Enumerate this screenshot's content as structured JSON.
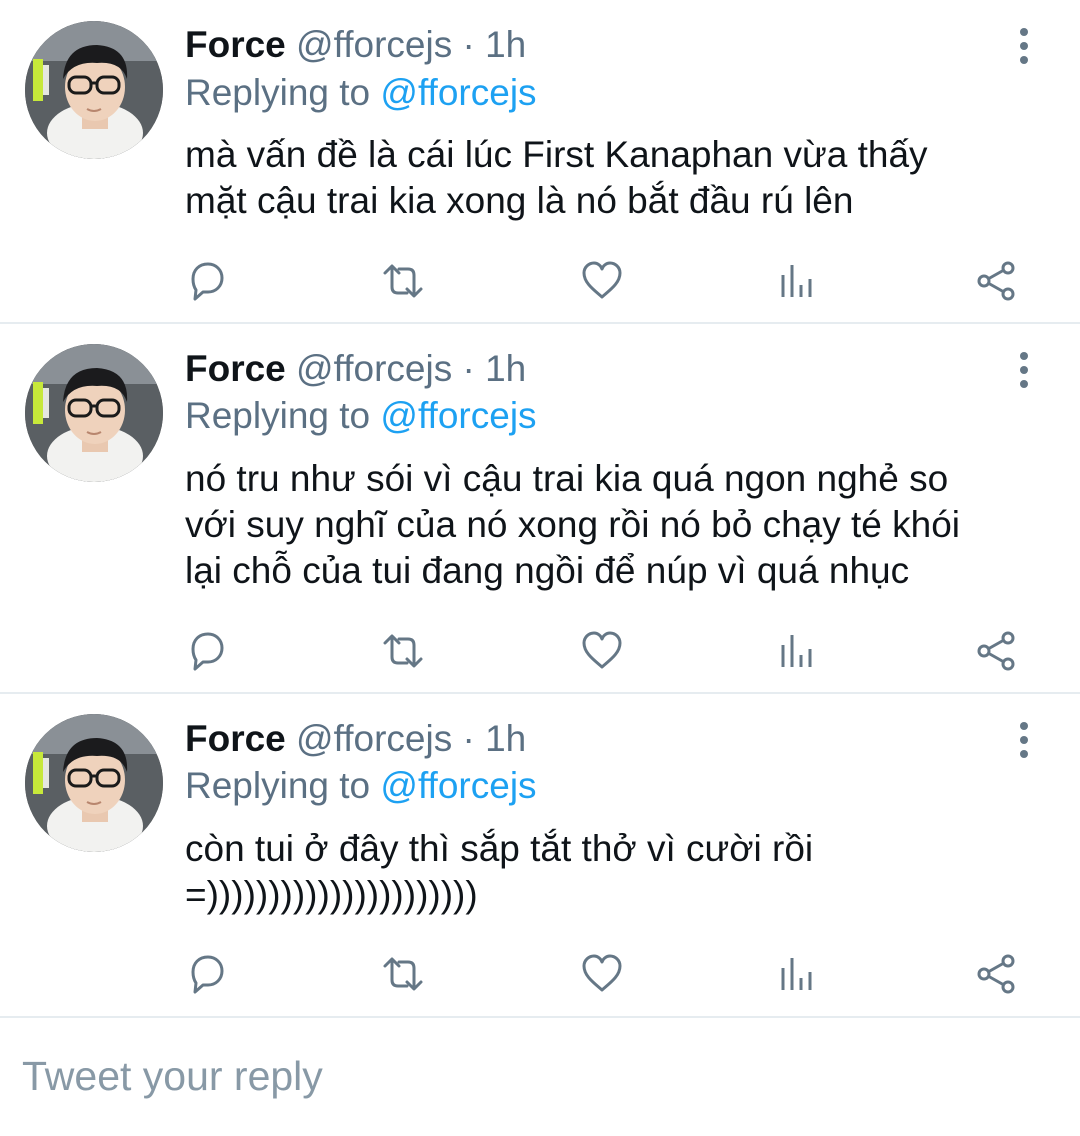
{
  "tweets": [
    {
      "name": "Force",
      "handle": "@fforcejs",
      "separator": "·",
      "time": "1h",
      "replying_prefix": "Replying to",
      "replying_to": "@fforcejs",
      "lines": [
        "mà vấn đề là cái lúc First Kanaphan vừa thấy",
        "mặt cậu trai kia xong là nó bắt đầu rú lên"
      ]
    },
    {
      "name": "Force",
      "handle": "@fforcejs",
      "separator": "·",
      "time": "1h",
      "replying_prefix": "Replying to",
      "replying_to": "@fforcejs",
      "lines": [
        "nó tru như sói vì cậu trai kia quá ngon nghẻ so",
        "với suy nghĩ của nó xong rồi nó bỏ chạy té khói",
        "lại chỗ của tui đang ngồi để núp vì quá nhục"
      ]
    },
    {
      "name": "Force",
      "handle": "@fforcejs",
      "separator": "·",
      "time": "1h",
      "replying_prefix": "Replying to",
      "replying_to": "@fforcejs",
      "lines": [
        "còn tui ở đây thì sắp tắt thở vì cười rồi",
        "=))))))))))))))))))))))"
      ]
    }
  ],
  "icons": {
    "reply": "reply-icon",
    "retweet": "retweet-icon",
    "like": "heart-icon",
    "stats": "analytics-icon",
    "share": "share-icon",
    "more": "more-vertical-icon"
  },
  "compose": {
    "placeholder": "Tweet your reply"
  },
  "colors": {
    "text": "#0f1419",
    "secondary": "#5b7083",
    "link": "#1da1f2",
    "icon": "#657786",
    "divider": "#e6ecf0"
  }
}
